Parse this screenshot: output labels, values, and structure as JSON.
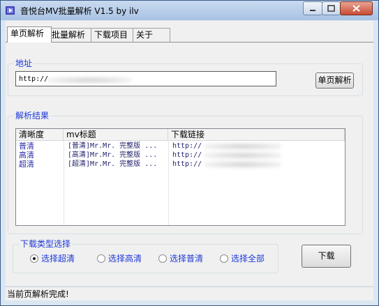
{
  "window": {
    "title": "音悦台MV批量解析 V1.5 by ilv"
  },
  "tabs": [
    {
      "label": "单页解析",
      "active": true
    },
    {
      "label": "批量解析"
    },
    {
      "label": "下载项目"
    },
    {
      "label": "关于"
    }
  ],
  "address": {
    "legend": "地址",
    "url_value": "http://",
    "parse_button": "单页解析"
  },
  "results": {
    "legend": "解析结果",
    "columns": [
      "清晰度",
      "mv标题",
      "下载链接"
    ],
    "rows": [
      {
        "quality": "普清",
        "title": "[普清]Mr.Mr. 完整版 ...",
        "link": "http://"
      },
      {
        "quality": "高清",
        "title": "[高清]Mr.Mr. 完整版 ...",
        "link": "http://"
      },
      {
        "quality": "超清",
        "title": "[超清]Mr.Mr. 完整版 ...",
        "link": "http://"
      }
    ]
  },
  "download_type": {
    "legend": "下载类型选择",
    "options": [
      {
        "label": "选择超清",
        "selected": true
      },
      {
        "label": "选择高清",
        "selected": false
      },
      {
        "label": "选择普清",
        "selected": false
      },
      {
        "label": "选择全部",
        "selected": false
      }
    ],
    "download_button": "下载"
  },
  "status": {
    "text": "当前页解析完成!"
  },
  "colors": {
    "accent": "#1e39d8",
    "row_text": "#2a2aa8"
  }
}
